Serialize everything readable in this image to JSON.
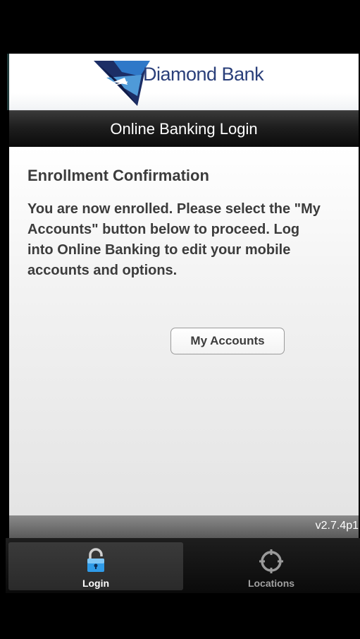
{
  "brand": {
    "name": "Diamond Bank",
    "logo_color": "#2a3f7a"
  },
  "header": {
    "title": "Online Banking Login"
  },
  "content": {
    "heading": "Enrollment Confirmation",
    "message": "You are now enrolled. Please select the \"My Accounts\" button below to proceed. Log into Online Banking to edit your mobile accounts and options.",
    "button_label": "My Accounts"
  },
  "footer": {
    "version": "v2.7.4p1"
  },
  "tabs": [
    {
      "label": "Login",
      "icon": "lock-icon",
      "active": true
    },
    {
      "label": "Locations",
      "icon": "crosshair-icon",
      "active": false
    }
  ]
}
